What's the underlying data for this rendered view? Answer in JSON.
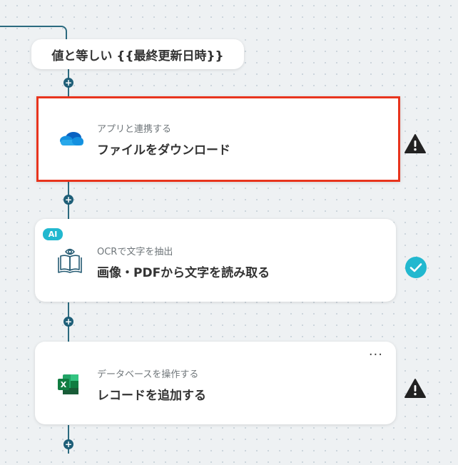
{
  "condition": {
    "label": "値と等しい {{最終更新日時}}"
  },
  "steps": [
    {
      "subtitle": "アプリと連携する",
      "title": "ファイルをダウンロード",
      "icon": "onedrive-icon",
      "status": "warning"
    },
    {
      "badge": "AI",
      "subtitle": "OCRで文字を抽出",
      "title": "画像・PDFから文字を読み取る",
      "icon": "ocr-book-icon",
      "status": "success"
    },
    {
      "subtitle": "データベースを操作する",
      "title": "レコードを追加する",
      "icon": "excel-icon",
      "status": "warning",
      "menu": "···"
    }
  ],
  "add_button_label": "+",
  "colors": {
    "connector": "#2b6a7f",
    "selection": "#e8341d",
    "success": "#22b8cf",
    "warning": "#222222"
  }
}
